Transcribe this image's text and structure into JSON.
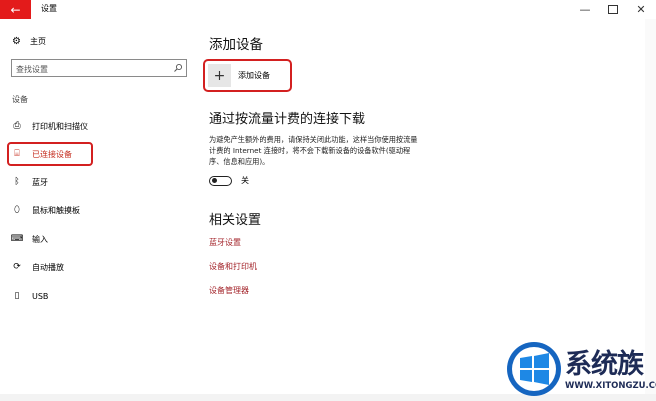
{
  "window": {
    "title": "设置",
    "back_icon": "arrow-left-icon",
    "controls": {
      "minimize": "—",
      "maximize": "",
      "close": "✕"
    }
  },
  "sidebar": {
    "home_label": "主页",
    "search_placeholder": "查找设置",
    "section_label": "设备",
    "items": [
      {
        "label": "打印机和扫描仪",
        "icon": "printer-icon",
        "glyph": "⎙"
      },
      {
        "label": "已连接设备",
        "icon": "connected-devices-icon",
        "glyph": "⌸",
        "active": true
      },
      {
        "label": "蓝牙",
        "icon": "bluetooth-icon",
        "glyph": "ᛒ"
      },
      {
        "label": "鼠标和触摸板",
        "icon": "mouse-icon",
        "glyph": "⬯"
      },
      {
        "label": "输入",
        "icon": "keyboard-icon",
        "glyph": "⌨"
      },
      {
        "label": "自动播放",
        "icon": "autoplay-icon",
        "glyph": "⟳"
      },
      {
        "label": "USB",
        "icon": "usb-icon",
        "glyph": "▯"
      }
    ]
  },
  "main": {
    "add_section_title": "添加设备",
    "add_button_label": "添加设备",
    "metered_title": "通过按流量计费的连接下载",
    "metered_desc_line1": "为避免产生额外的费用，请保持关闭此功能，这样当你使用按流量",
    "metered_desc_line2": "计费的 Internet 连接时，将不会下载新设备的设备软件(驱动程",
    "metered_desc_line3": "序、信息和应用)。",
    "toggle_label": "关",
    "toggle_on": false,
    "related_title": "相关设置",
    "links": [
      "蓝牙设置",
      "设备和打印机",
      "设备管理器"
    ]
  },
  "watermark": {
    "text": "系统族",
    "url": "WWW.XITONGZU.COM"
  },
  "colors": {
    "accent_red": "#e31b1b",
    "link": "#a4262c",
    "highlight_box": "#d32020"
  }
}
